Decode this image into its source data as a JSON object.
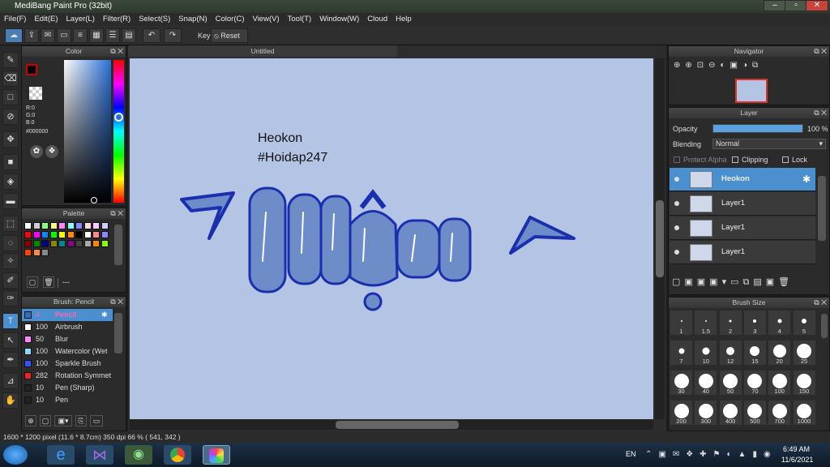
{
  "window": {
    "title": "MediBang Paint Pro (32bit)"
  },
  "menu": [
    "File(F)",
    "Edit(E)",
    "Layer(L)",
    "Filter(R)",
    "Select(S)",
    "Snap(N)",
    "Color(C)",
    "View(V)",
    "Tool(T)",
    "Window(W)",
    "Cloud",
    "Help"
  ],
  "toolbar": {
    "key_label": "Key",
    "reset_label": "Reset"
  },
  "color_panel": {
    "title": "Color",
    "r": "R:0",
    "g": "G:0",
    "b": "B:0",
    "hex": "#000000"
  },
  "palette_panel": {
    "title": "Palette",
    "dash": "---"
  },
  "brush_panel": {
    "title": "Brush: Pencil",
    "items": [
      {
        "size": "4",
        "name": "Pencil",
        "color": "#3070c0"
      },
      {
        "size": "100",
        "name": "Airbrush",
        "color": "#ffffff"
      },
      {
        "size": "50",
        "name": "Blur",
        "color": "#ff88ff"
      },
      {
        "size": "100",
        "name": "Watercolor (Wet",
        "color": "#88ddff"
      },
      {
        "size": "100",
        "name": "Sparkle Brush",
        "color": "#3355ff"
      },
      {
        "size": "282",
        "name": "Rotation Symmet",
        "color": "#ee2222"
      },
      {
        "size": "10",
        "name": "Pen (Sharp)",
        "color": "#222222"
      },
      {
        "size": "10",
        "name": "Pen",
        "color": "#222222"
      }
    ]
  },
  "canvas": {
    "tab": "Untitled",
    "text1": "Heokon",
    "text2": "#Hoidap247",
    "art_text": "Mệt",
    "bg": "#b4c4e4"
  },
  "navigator": {
    "title": "Navigator"
  },
  "layer_panel": {
    "title": "Layer",
    "opacity_label": "Opacity",
    "opacity_value": "100 %",
    "opacity": 1.0,
    "blending_label": "Blending",
    "blending_value": "Normal",
    "protect_alpha": "Protect Alpha",
    "clipping": "Clipping",
    "lock": "Lock",
    "layers": [
      {
        "name": "Heokon",
        "selected": true
      },
      {
        "name": "Layer1",
        "selected": false
      },
      {
        "name": "Layer1",
        "selected": false
      },
      {
        "name": "Layer1",
        "selected": false
      }
    ]
  },
  "brush_size_panel": {
    "title": "Brush Size",
    "sizes": [
      "1",
      "1.5",
      "2",
      "3",
      "4",
      "5",
      "7",
      "10",
      "12",
      "15",
      "20",
      "25",
      "30",
      "40",
      "50",
      "70",
      "100",
      "150",
      "200",
      "300",
      "400",
      "500",
      "700",
      "1000"
    ]
  },
  "status": {
    "text": "1600 * 1200 pixel   (11.6 * 8.7cm)   350 dpi   66 %   ( 541, 342 )"
  },
  "taskbar": {
    "lang": "EN",
    "time": "6:49 AM",
    "date": "11/6/2021"
  },
  "colors": {
    "accent": "#4a90d0",
    "art_fill": "#6e8cc8",
    "art_stroke": "#1a2fb0"
  }
}
